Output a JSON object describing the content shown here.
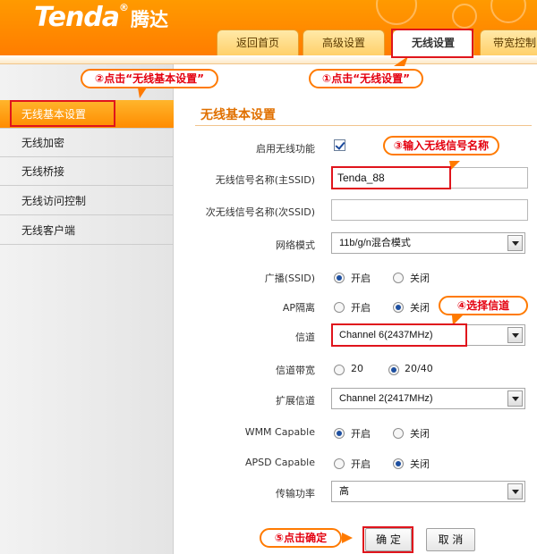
{
  "brand": {
    "name_en": "Tenda",
    "reg": "®",
    "name_cn": "腾达"
  },
  "tabs": [
    {
      "label": "返回首页",
      "active": false
    },
    {
      "label": "高级设置",
      "active": false
    },
    {
      "label": "无线设置",
      "active": true
    },
    {
      "label": "带宽控制",
      "active": false
    }
  ],
  "sidebar": {
    "items": [
      {
        "label": "无线基本设置",
        "active": true
      },
      {
        "label": "无线加密",
        "active": false
      },
      {
        "label": "无线桥接",
        "active": false
      },
      {
        "label": "无线访问控制",
        "active": false
      },
      {
        "label": "无线客户端",
        "active": false
      }
    ]
  },
  "form": {
    "title": "无线基本设置",
    "enable_label": "启用无线功能",
    "enable_checked": true,
    "ssid_label": "无线信号名称(主SSID)",
    "ssid_value": "Tenda_88",
    "ssid2_label": "次无线信号名称(次SSID)",
    "ssid2_value": "",
    "mode_label": "网络模式",
    "mode_value": "11b/g/n混合模式",
    "broadcast_label": "广播(SSID)",
    "broadcast_on": "开启",
    "broadcast_off": "关闭",
    "ap_label": "AP隔离",
    "ap_on": "开启",
    "ap_off": "关闭",
    "channel_label": "信道",
    "channel_value": "Channel 6(2437MHz)",
    "bandwidth_label": "信道带宽",
    "bandwidth_20": "20",
    "bandwidth_40": "20/40",
    "ext_label": "扩展信道",
    "ext_value": "Channel 2(2417MHz)",
    "wmm_label": "WMM Capable",
    "wmm_on": "开启",
    "wmm_off": "关闭",
    "apsd_label": "APSD Capable",
    "apsd_on": "开启",
    "apsd_off": "关闭",
    "power_label": "传输功率",
    "power_value": "高",
    "ok_label": "确 定",
    "cancel_label": "取 消"
  },
  "annotations": {
    "step1": "①点击“无线设置”",
    "step2": "②点击“无线基本设置”",
    "step3": "③输入无线信号名称",
    "step4": "④选择信道",
    "step5": "⑤点击确定"
  },
  "colors": {
    "brand_orange": "#ff8a00",
    "annotation_red": "#e0141c",
    "radio_blue": "#1d4fa0"
  }
}
